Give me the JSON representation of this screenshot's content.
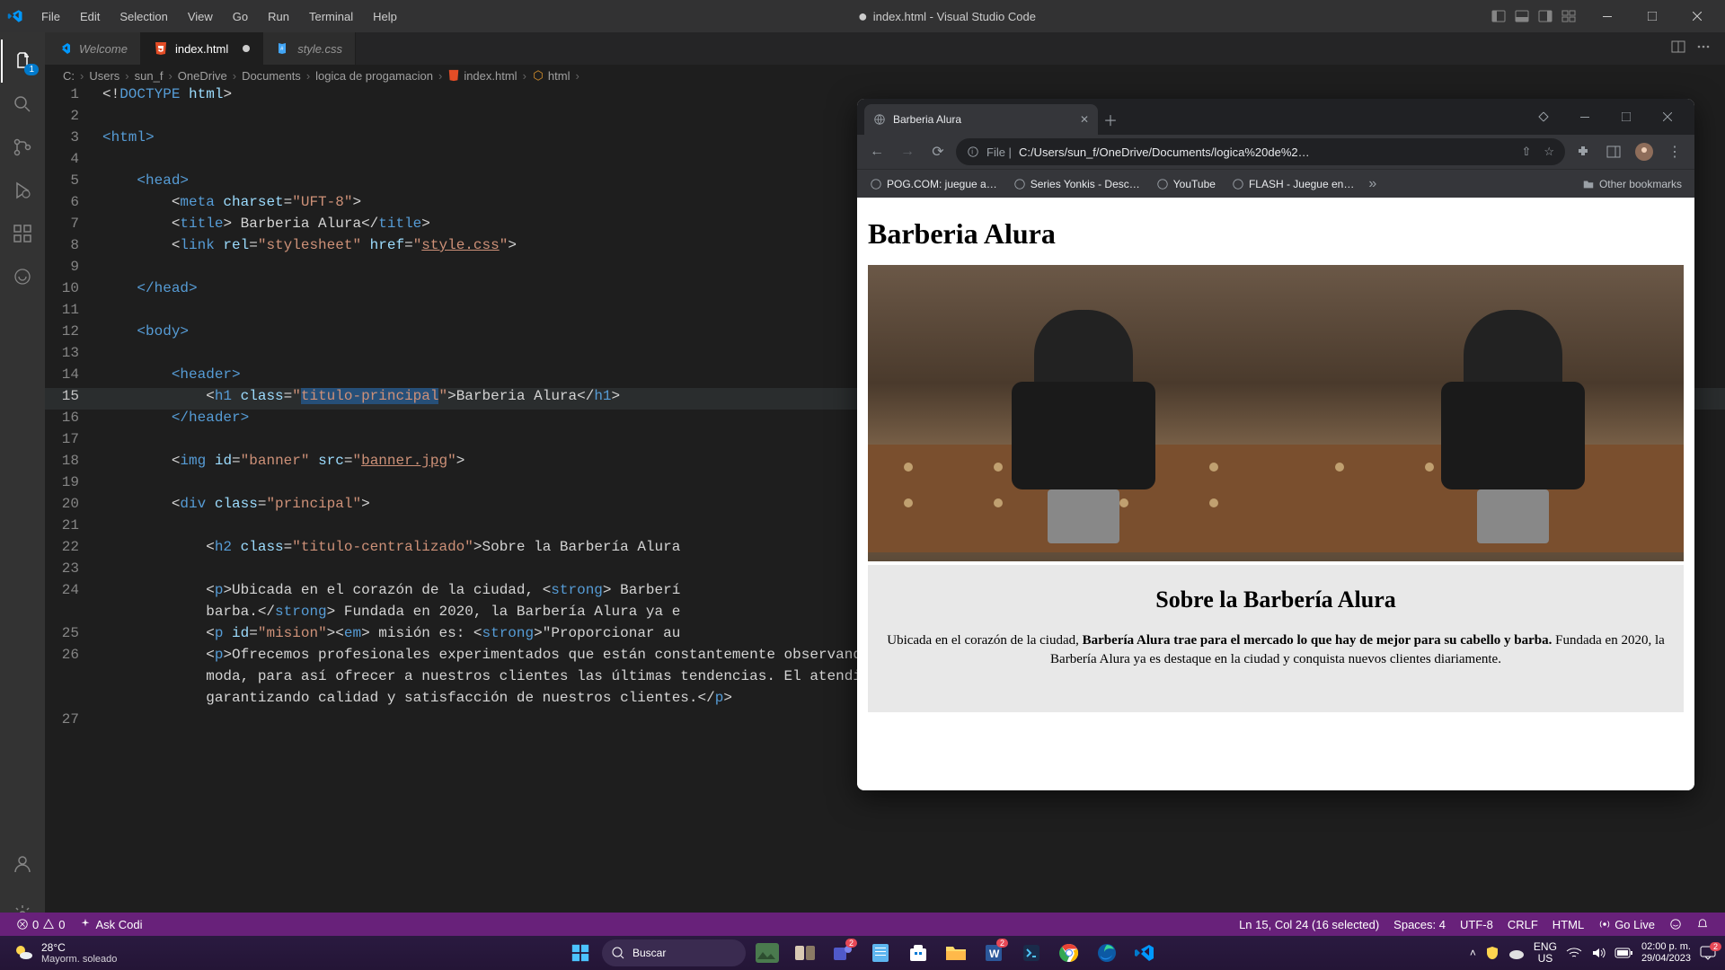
{
  "app": {
    "title": "index.html - Visual Studio Code",
    "modified": "●"
  },
  "menu": [
    "File",
    "Edit",
    "Selection",
    "View",
    "Go",
    "Run",
    "Terminal",
    "Help"
  ],
  "tabs": [
    {
      "icon": "vscode",
      "label": "Welcome",
      "active": false
    },
    {
      "icon": "html",
      "label": "index.html",
      "active": true,
      "modified": true
    },
    {
      "icon": "css",
      "label": "style.css",
      "active": false
    }
  ],
  "activity_badge": "1",
  "breadcrumb": [
    "C:",
    "Users",
    "sun_f",
    "OneDrive",
    "Documents",
    "logica de progamacion",
    "",
    "index.html",
    "",
    "html",
    ""
  ],
  "breadcrumb_file": "index.html",
  "breadcrumb_tag": "html",
  "code": {
    "l1a": "<!",
    "l1b": "DOCTYPE",
    "l1c": " html",
    "l1d": ">",
    "l3": "<html>",
    "l5": "    <head>",
    "l6a": "        <",
    "l6b": "meta",
    "l6c": " charset",
    "l6d": "=",
    "l6e": "\"UFT-8\"",
    "l6f": ">",
    "l7a": "        <",
    "l7b": "title",
    "l7c": "> Barberia Alura</",
    "l7d": "title",
    "l7e": ">",
    "l8a": "        <",
    "l8b": "link",
    "l8c": " rel",
    "l8d": "=",
    "l8e": "\"stylesheet\"",
    "l8f": " href",
    "l8g": "=",
    "l8h": "\"",
    "l8i": "style.css",
    "l8j": "\"",
    "l8k": ">",
    "l10": "    </head>",
    "l12": "    <body>",
    "l14": "        <header>",
    "l15a": "            <",
    "l15b": "h1",
    "l15c": " class",
    "l15d": "=",
    "l15e": "\"",
    "l15f": "titulo-principal",
    "l15g": "\"",
    "l15h": ">Barberia Alura</",
    "l15i": "h1",
    "l15j": ">",
    "l16": "        </header>",
    "l18a": "        <",
    "l18b": "img",
    "l18c": " id",
    "l18d": "=",
    "l18e": "\"banner\"",
    "l18f": " src",
    "l18g": "=",
    "l18h": "\"",
    "l18i": "banner.jpg",
    "l18j": "\"",
    "l18k": ">",
    "l20a": "        <",
    "l20b": "div",
    "l20c": " class",
    "l20d": "=",
    "l20e": "\"principal\"",
    "l20f": ">",
    "l22a": "            <",
    "l22b": "h2",
    "l22c": " class",
    "l22d": "=",
    "l22e": "\"titulo-centralizado\"",
    "l22f": ">Sobre la Barbería Alura",
    "l24a": "            <",
    "l24b": "p",
    "l24c": ">Ubicada en el corazón de la ciudad, <",
    "l24d": "strong",
    "l24e": "> Barberí",
    "l24f": "            barba.</",
    "l24g": "strong",
    "l24h": "> Fundada en 2020, la Barbería Alura ya e",
    "l25a": "            <",
    "l25b": "p",
    "l25c": " id",
    "l25d": "=",
    "l25e": "\"mision\"",
    "l25f": "><",
    "l25g": "em",
    "l25h": "> misión es: <",
    "l25i": "strong",
    "l25j": ">\"Proporcionar au",
    "l26a": "            <",
    "l26b": "p",
    "l26c": ">Ofrecemos profesionales experimentados que están constantemente observando los cambios y movimiento en el mundo de la",
    "l26d": "            moda, para así ofrecer a nuestros clientes las últimas tendencias. El atendimiento posee un padrón de excelencia y agilidad,",
    "l26e": "            garantizando calidad y satisfacción de nuestros clientes.</",
    "l26f": "p",
    "l26g": ">"
  },
  "statusbar": {
    "errors": "0",
    "warnings": "0",
    "codi": "Ask Codi",
    "cursor": "Ln 15, Col 24 (16 selected)",
    "spaces": "Spaces: 4",
    "encoding": "UTF-8",
    "eol": "CRLF",
    "lang": "HTML",
    "golive": "Go Live"
  },
  "taskbar": {
    "temp": "28°C",
    "weather": "Mayorm. soleado",
    "search": "Buscar",
    "lang1": "ENG",
    "lang2": "US",
    "time": "02:00 p. m.",
    "date": "29/04/2023",
    "notif": "2",
    "teams_badge": "2"
  },
  "chrome": {
    "tab_title": "Barberia Alura",
    "url_prefix": "File |",
    "url": "C:/Users/sun_f/OneDrive/Documents/logica%20de%2…",
    "bookmarks": [
      "POG.COM: juegue a…",
      "Series Yonkis - Desc…",
      "YouTube",
      "FLASH - Juegue en…"
    ],
    "other_bookmarks": "Other bookmarks",
    "page": {
      "h1": "Barberia Alura",
      "h2": "Sobre la Barbería Alura",
      "p1a": "Ubicada en el corazón de la ciudad, ",
      "p1b": "Barbería Alura trae para el mercado lo que hay de mejor para su cabello y barba.",
      "p1c": " Fundada en 2020, la Barbería Alura ya es destaque en la ciudad y conquista nuevos clientes diariamente."
    }
  }
}
